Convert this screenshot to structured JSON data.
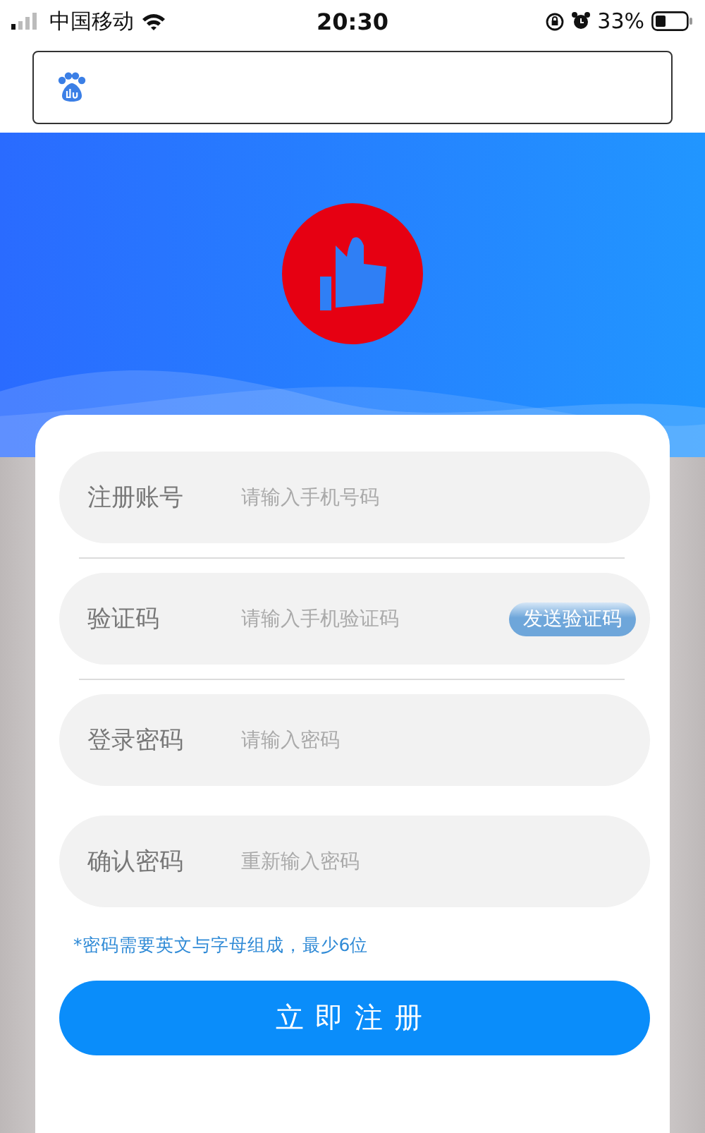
{
  "status_bar": {
    "carrier": "中国移动",
    "time": "20:30",
    "battery": "33%"
  },
  "register_form": {
    "fields": [
      {
        "label": "注册账号",
        "placeholder": "请输入手机号码",
        "divider": true
      },
      {
        "label": "验证码",
        "placeholder": "请输入手机验证码",
        "divider": true,
        "kind": "code",
        "action": "发送验证码"
      },
      {
        "label": "登录密码",
        "placeholder": "请输入密码",
        "divider": false
      },
      {
        "label": "确认密码",
        "placeholder": "重新输入密码",
        "divider": false
      }
    ],
    "hint": "*密码需要英文与字母组成，最少6位",
    "submit": "立即注册"
  }
}
